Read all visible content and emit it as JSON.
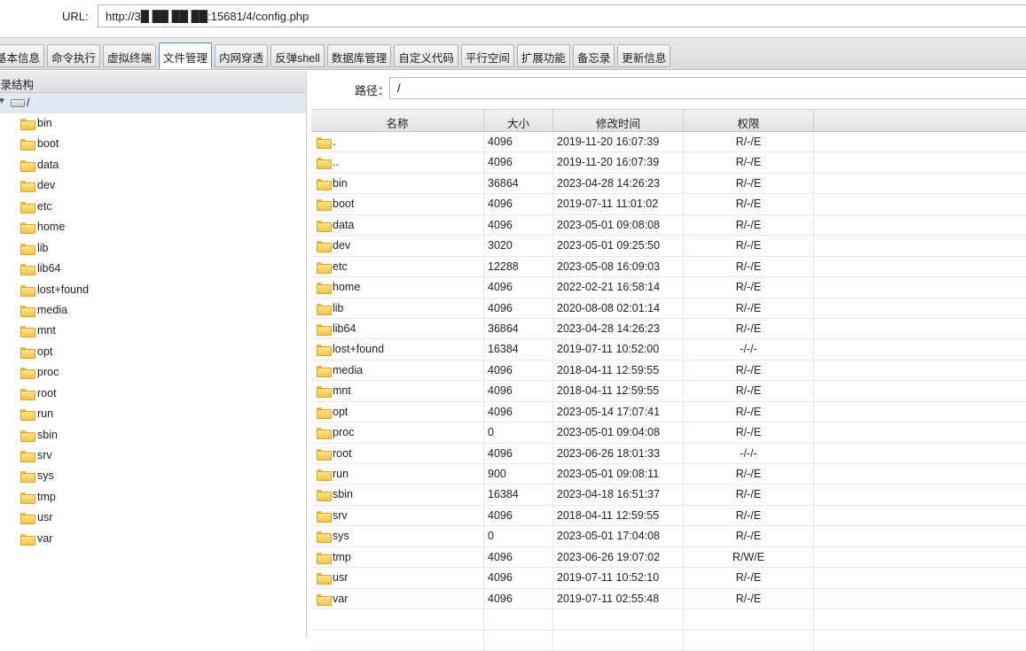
{
  "url_bar": {
    "label": "URL:",
    "value": "http://3█ ██ ██ ██:15681/4/config.php"
  },
  "tabs": [
    {
      "label": "基本信息"
    },
    {
      "label": "命令执行"
    },
    {
      "label": "虚拟终端"
    },
    {
      "label": "文件管理",
      "active": true
    },
    {
      "label": "内网穿透"
    },
    {
      "label": "反弹shell"
    },
    {
      "label": "数据库管理"
    },
    {
      "label": "自定义代码"
    },
    {
      "label": "平行空间"
    },
    {
      "label": "扩展功能"
    },
    {
      "label": "备忘录"
    },
    {
      "label": "更新信息"
    }
  ],
  "left_panel": {
    "title": "目录结构",
    "root": "/",
    "dirs": [
      "bin",
      "boot",
      "data",
      "dev",
      "etc",
      "home",
      "lib",
      "lib64",
      "lost+found",
      "media",
      "mnt",
      "opt",
      "proc",
      "root",
      "run",
      "sbin",
      "srv",
      "sys",
      "tmp",
      "usr",
      "var"
    ]
  },
  "path_bar": {
    "label": "路径：",
    "value": "/"
  },
  "file_table": {
    "headers": {
      "name": "名称",
      "size": "大小",
      "mtime": "修改时间",
      "perm": "权限"
    },
    "rows": [
      {
        "name": ".",
        "size": "4096",
        "mtime": "2019-11-20 16:07:39",
        "perm": "R/-/E"
      },
      {
        "name": "..",
        "size": "4096",
        "mtime": "2019-11-20 16:07:39",
        "perm": "R/-/E"
      },
      {
        "name": "bin",
        "size": "36864",
        "mtime": "2023-04-28 14:26:23",
        "perm": "R/-/E"
      },
      {
        "name": "boot",
        "size": "4096",
        "mtime": "2019-07-11 11:01:02",
        "perm": "R/-/E"
      },
      {
        "name": "data",
        "size": "4096",
        "mtime": "2023-05-01 09:08:08",
        "perm": "R/-/E"
      },
      {
        "name": "dev",
        "size": "3020",
        "mtime": "2023-05-01 09:25:50",
        "perm": "R/-/E"
      },
      {
        "name": "etc",
        "size": "12288",
        "mtime": "2023-05-08 16:09:03",
        "perm": "R/-/E"
      },
      {
        "name": "home",
        "size": "4096",
        "mtime": "2022-02-21 16:58:14",
        "perm": "R/-/E"
      },
      {
        "name": "lib",
        "size": "4096",
        "mtime": "2020-08-08 02:01:14",
        "perm": "R/-/E"
      },
      {
        "name": "lib64",
        "size": "36864",
        "mtime": "2023-04-28 14:26:23",
        "perm": "R/-/E"
      },
      {
        "name": "lost+found",
        "size": "16384",
        "mtime": "2019-07-11 10:52:00",
        "perm": "-/-/-"
      },
      {
        "name": "media",
        "size": "4096",
        "mtime": "2018-04-11 12:59:55",
        "perm": "R/-/E"
      },
      {
        "name": "mnt",
        "size": "4096",
        "mtime": "2018-04-11 12:59:55",
        "perm": "R/-/E"
      },
      {
        "name": "opt",
        "size": "4096",
        "mtime": "2023-05-14 17:07:41",
        "perm": "R/-/E"
      },
      {
        "name": "proc",
        "size": "0",
        "mtime": "2023-05-01 09:04:08",
        "perm": "R/-/E"
      },
      {
        "name": "root",
        "size": "4096",
        "mtime": "2023-06-26 18:01:33",
        "perm": "-/-/-"
      },
      {
        "name": "run",
        "size": "900",
        "mtime": "2023-05-01 09:08:11",
        "perm": "R/-/E"
      },
      {
        "name": "sbin",
        "size": "16384",
        "mtime": "2023-04-18 16:51:37",
        "perm": "R/-/E"
      },
      {
        "name": "srv",
        "size": "4096",
        "mtime": "2018-04-11 12:59:55",
        "perm": "R/-/E"
      },
      {
        "name": "sys",
        "size": "0",
        "mtime": "2023-05-01 17:04:08",
        "perm": "R/-/E"
      },
      {
        "name": "tmp",
        "size": "4096",
        "mtime": "2023-06-26 19:07:02",
        "perm": "R/W/E"
      },
      {
        "name": "usr",
        "size": "4096",
        "mtime": "2019-07-11 10:52:10",
        "perm": "R/-/E"
      },
      {
        "name": "var",
        "size": "4096",
        "mtime": "2019-07-11 02:55:48",
        "perm": "R/-/E"
      }
    ]
  }
}
